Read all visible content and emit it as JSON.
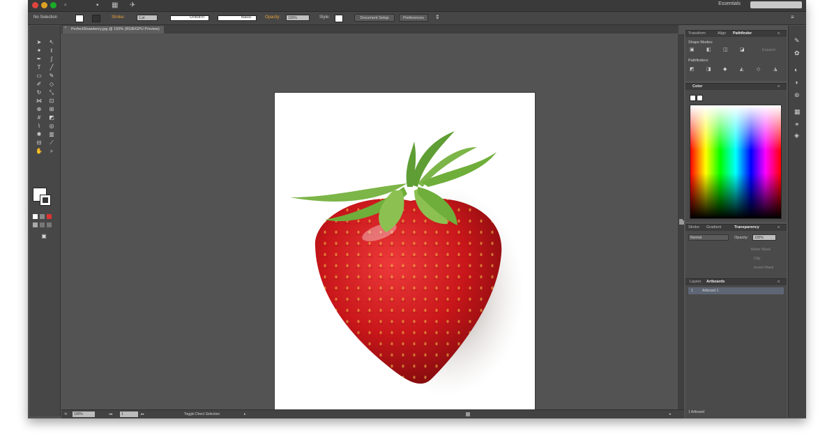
{
  "app": {
    "workspace": "Essentials"
  },
  "controlbar": {
    "selection": "No Selection",
    "stroke_label": "Stroke:",
    "stroke_value": "1 pt",
    "brush_label": "Uniform",
    "style_label": "Basic",
    "opacity_label": "Opacity:",
    "opacity_value": "100%",
    "style2_label": "Style:",
    "doc_setup": "Document Setup",
    "preferences": "Preferences"
  },
  "document": {
    "tab_title": "PerfectStrawberry.jpg @ 100% (RGB/GPU Preview)"
  },
  "status": {
    "zoom": "100%",
    "page": "1",
    "mode": "Toggle Direct Selection"
  },
  "panels": {
    "top_tabs": [
      "Transform",
      "Align",
      "Pathfinder"
    ],
    "shape_modes": "Shape Modes:",
    "expand": "Expand",
    "pathfinders": "Pathfinders:",
    "color_tab": "Color",
    "lower_tabs": [
      "Stroke",
      "Gradient",
      "Transparency"
    ],
    "blend_mode": "Normal",
    "opacity_label": "Opacity:",
    "opacity_value": "100%",
    "make_mask": "Make Mask",
    "clip": "Clip",
    "invert_mask": "Invert Mask",
    "layers_tabs": [
      "Layers",
      "Artboards"
    ],
    "artboard_row": "Artboard 1",
    "footer": "1 Artboard"
  },
  "colors": {
    "accent": "#e8a23a",
    "window_bg": "#535353",
    "strawberry": "#c8161a",
    "leaf": "#6fae3a"
  }
}
